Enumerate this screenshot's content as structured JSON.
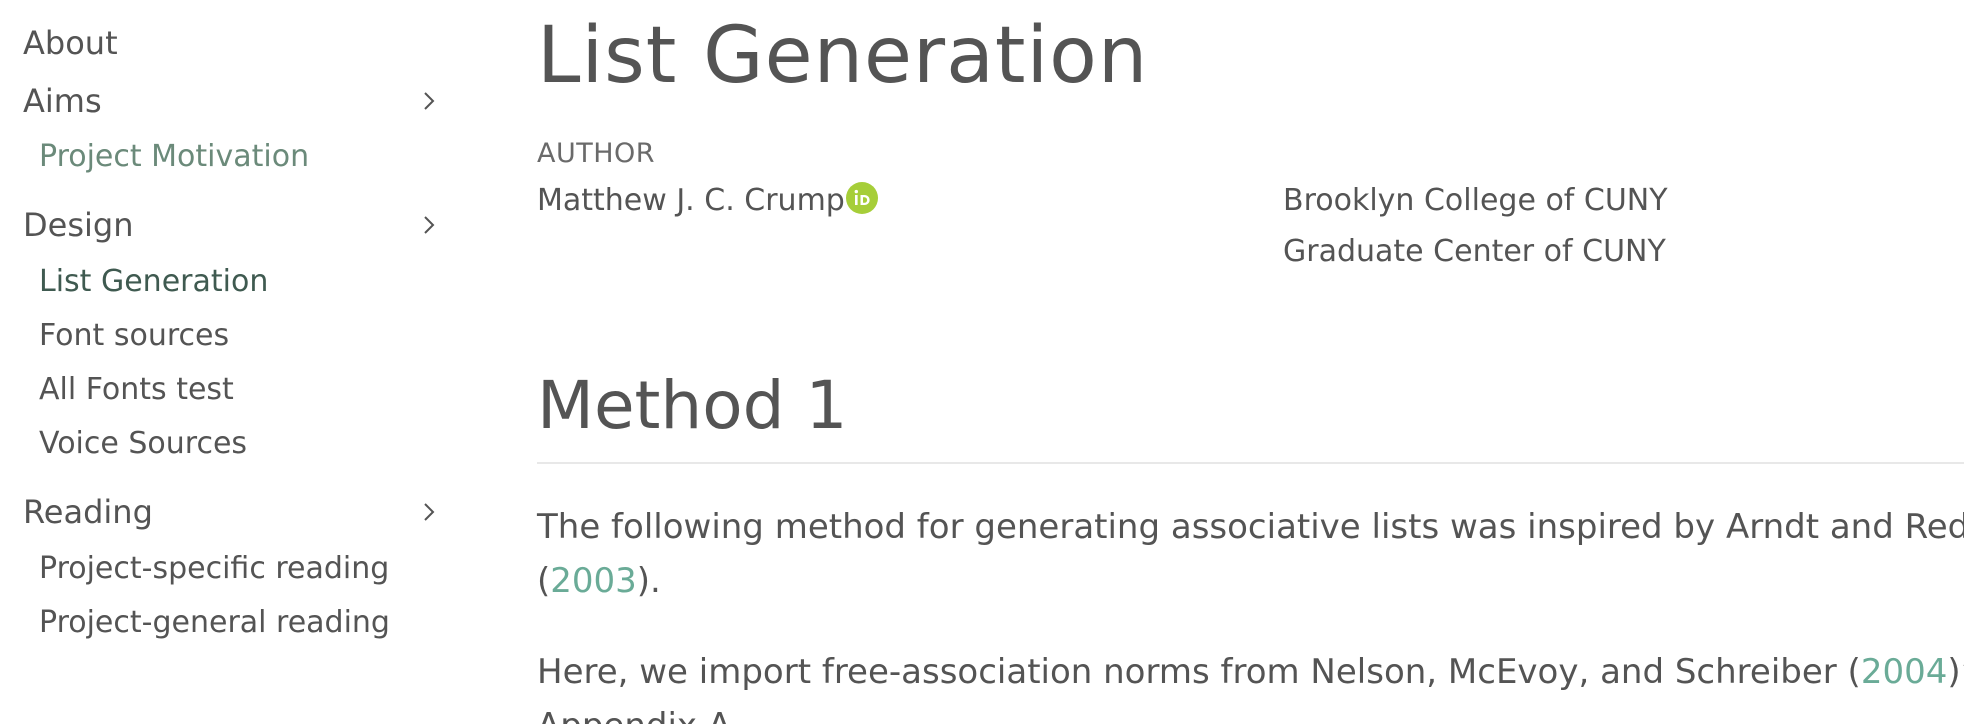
{
  "sidebar": {
    "about": "About",
    "aims": {
      "label": "Aims",
      "items": [
        "Project Motivation"
      ]
    },
    "design": {
      "label": "Design",
      "items": [
        "List Generation",
        "Font sources",
        "All Fonts test",
        "Voice Sources"
      ]
    },
    "reading": {
      "label": "Reading",
      "items": [
        "Project-specific reading",
        "Project-general reading"
      ]
    }
  },
  "main": {
    "title": "List Generation",
    "author_label": "AUTHOR",
    "author_name": "Matthew J. C. Crump",
    "affiliations": [
      "Brooklyn College of CUNY",
      "Graduate Center of CUNY"
    ],
    "section_title": "Method 1",
    "para1": {
      "line1": "The following method for generating associative lists was inspired by Arndt and Reder",
      "open": "(",
      "cite": "2003",
      "close": ")."
    },
    "para2": {
      "before": "Here, we import free-association norms from Nelson, McEvoy, and Schreiber (",
      "cite": "2004",
      "after": ")’s",
      "line2": "Appendix A"
    }
  },
  "colors": {
    "text": "#545454",
    "link": "#6aab97",
    "active_nav": "#3f5a50",
    "orcid": "#a6ce39"
  },
  "icons": {
    "chevron": "chevron-right-icon",
    "orcid": "orcid-icon"
  }
}
